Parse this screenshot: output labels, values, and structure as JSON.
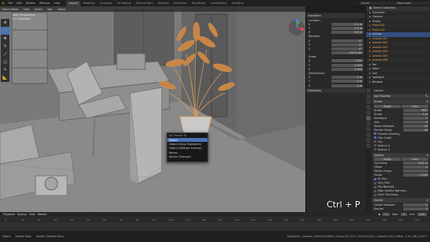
{
  "topbar": {
    "menus": [
      "File",
      "Edit",
      "Render",
      "Window",
      "Help"
    ],
    "workspaces": [
      "Layout",
      "Modeling",
      "Sculpting",
      "UV Editing",
      "Texture Paint",
      "Shading",
      "Animation",
      "Rendering",
      "Compositing",
      "Scripting"
    ],
    "active_workspace": "Layout",
    "scene": "Scene",
    "view_layer": "View Layer"
  },
  "viewport": {
    "header_items": [
      "Object Mode",
      "View",
      "Select",
      "Add",
      "Object"
    ],
    "info_line1": "User Perspective",
    "info_line2": "(1) Collection",
    "keycast": "Ctrl + P"
  },
  "tools": [
    "cursor",
    "select",
    "move",
    "rotate",
    "scale",
    "transform",
    "annotate",
    "measure"
  ],
  "context_menu": {
    "title": "Set Parent To",
    "items": [
      {
        "label": "Object",
        "shortcut": "",
        "selected": true
      },
      {
        "label": "Object (Keep Transform)",
        "shortcut": "",
        "selected": false
      },
      {
        "label": "Object (Without Inverse)",
        "shortcut": "",
        "selected": false
      },
      {
        "label": "Vertex",
        "shortcut": "",
        "selected": false
      },
      {
        "label": "Vertex (Triangle)",
        "shortcut": "",
        "selected": false
      }
    ]
  },
  "npanel": {
    "transform_header": "Transform",
    "location_label": "Location:",
    "location": [
      {
        "axis": "X",
        "value": "-0.1 m"
      },
      {
        "axis": "Y",
        "value": "1.4 m"
      },
      {
        "axis": "Z",
        "value": "0.8 m"
      }
    ],
    "rotation_label": "Rotation:",
    "rotation": [
      {
        "axis": "X",
        "value": "0°"
      },
      {
        "axis": "Y",
        "value": "0°"
      },
      {
        "axis": "Z",
        "value": "0°"
      }
    ],
    "mode": "XYZ Euler",
    "scale_label": "Scale:",
    "scale": [
      {
        "axis": "X",
        "value": "1.000"
      },
      {
        "axis": "Y",
        "value": "1.000"
      },
      {
        "axis": "Z",
        "value": "1.000"
      }
    ],
    "dimensions_label": "Dimensions:",
    "dimensions": [
      {
        "axis": "X",
        "value": "0 m"
      },
      {
        "axis": "Y",
        "value": "0 m"
      },
      {
        "axis": "Z",
        "value": "0 m"
      }
    ],
    "properties_header": "Properties"
  },
  "outliner": {
    "header": "Scene Collection",
    "items": [
      "Collection",
      "Camera",
      "Empty",
      "Plant.001",
      "Plant.002",
      "Leaves",
      "Leaves.001",
      "Leaves.002",
      "Leaves.003",
      "Leaves.004",
      "Leaves.005",
      "Leaves.006",
      "Pot",
      "Stem",
      "Soil",
      "Spotlight",
      "Window"
    ]
  },
  "properties": {
    "object_name": "Leaves",
    "modifier_header": "Add Modifier",
    "screw_header": "Screw",
    "apply_label": "Apply",
    "copy_label": "Copy",
    "screw_rows": [
      {
        "label": "Angle",
        "value": "360°"
      },
      {
        "label": "Screw",
        "value": "0 m"
      },
      {
        "label": "Iterations",
        "value": "1"
      },
      {
        "label": "Axis",
        "value": "Z"
      },
      {
        "label": "Steps Viewport",
        "value": "16"
      },
      {
        "label": "Render Steps",
        "value": "16"
      }
    ],
    "screw_checks": [
      "Smooth Shading",
      "Calc Order",
      "Flip",
      "Stretch U",
      "Stretch V"
    ],
    "solidify_header": "Solidify",
    "solidify_rows": [
      {
        "label": "Thickness",
        "value": "0.01 m"
      },
      {
        "label": "Offset",
        "value": "-1"
      },
      {
        "label": "Vertex Group",
        "value": ""
      },
      {
        "label": "Factor",
        "value": "0.000"
      }
    ],
    "solidify_checks": [
      "Fill Rim",
      "Only Rim",
      "Flip Normals",
      "High Quality Normals",
      "Even Thickness"
    ],
    "subsurf_header": "Subdiv",
    "subsurf_rows": [
      {
        "label": "Levels Viewport",
        "value": "1"
      },
      {
        "label": "Render",
        "value": "2"
      }
    ]
  },
  "timeline": {
    "menus": [
      "Playback",
      "Keying",
      "View",
      "Marker"
    ],
    "frames": [
      "0",
      "10",
      "20",
      "30",
      "40",
      "50",
      "60",
      "70",
      "80",
      "90",
      "100",
      "110",
      "120",
      "130",
      "140",
      "150",
      "160",
      "170",
      "180",
      "190",
      "200",
      "210",
      "220",
      "230",
      "240",
      "250"
    ],
    "start_label": "Start",
    "start": "1",
    "end_label": "End",
    "end": "250",
    "current": "1"
  },
  "status": {
    "left": [
      "Select",
      "Rotate View",
      "Object Context Menu"
    ],
    "right": "Collection | Leaves | Verts:243,894 | Faces:227,112 | Tris:451,812 | Objects:1/23 | Mem: 1.01 GiB | 2.82.7"
  },
  "colors": {
    "accent": "#4772b3",
    "selection": "#e8a150",
    "viewport_bg": "#6c6c6c"
  }
}
